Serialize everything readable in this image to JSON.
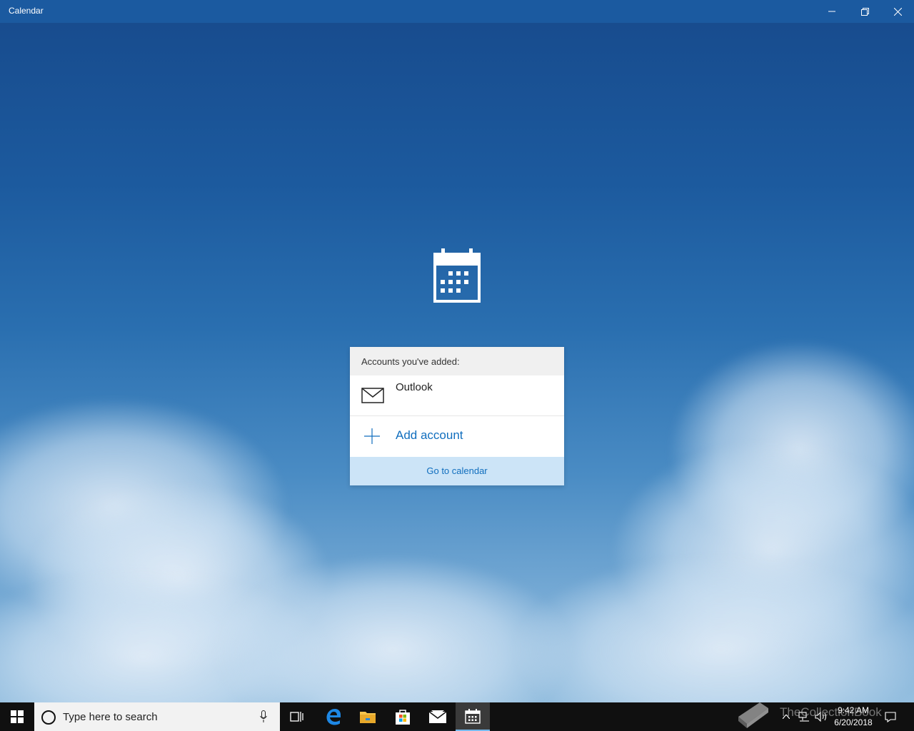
{
  "window": {
    "title": "Calendar",
    "controls": [
      "minimize",
      "restore",
      "close"
    ]
  },
  "panel": {
    "header": "Accounts you've added:",
    "accounts": [
      {
        "name": "Outlook",
        "icon": "mail-icon"
      }
    ],
    "add_account_label": "Add account",
    "go_to_calendar_label": "Go to calendar"
  },
  "taskbar": {
    "search_placeholder": "Type here to search",
    "pinned": [
      "task-view-icon",
      "edge-icon",
      "file-explorer-icon",
      "store-icon",
      "mail-icon",
      "calendar-icon"
    ],
    "active_app": "calendar-icon",
    "clock": {
      "time": "9:42 AM",
      "date": "6/20/2018"
    }
  },
  "watermark": "TheCollectionBook",
  "colors": {
    "titlebar": "#1b5aa0",
    "accent": "#106ebe",
    "goto_bg": "#cce4f7",
    "taskbar": "#101010"
  }
}
